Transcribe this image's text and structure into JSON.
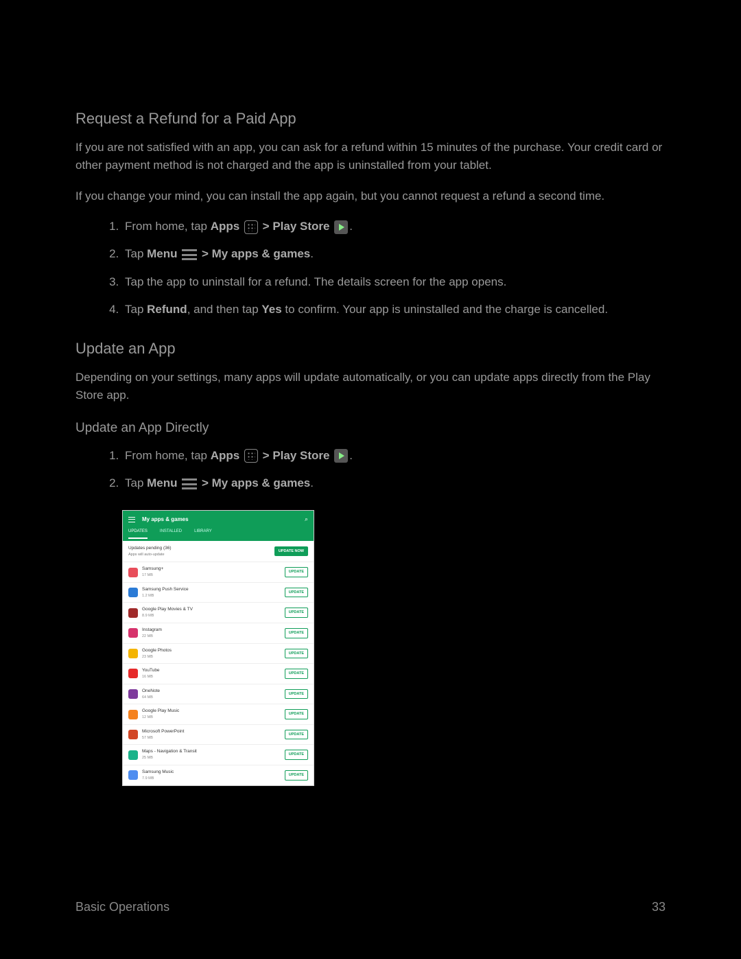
{
  "sections": {
    "refund_title": "Request a Refund for a Paid App",
    "refund_p1": "If you are not satisfied with an app, you can ask for a refund within 15 minutes of the purchase. Your credit card or other payment method is not charged and the app is uninstalled from your tablet.",
    "refund_p2": "If you change your mind, you can install the app again, but you cannot request a refund a second time.",
    "refund_steps": {
      "s1a": "From home, tap ",
      "s1b": "Apps",
      "s1c": " > ",
      "s1d": "Play Store",
      "s1e": ".",
      "s2a": "Tap ",
      "s2b": "Menu",
      "s2c": " > ",
      "s2d": "My apps & games",
      "s2e": ".",
      "s3": "Tap the app to uninstall for a refund. The details screen for the app opens.",
      "s4a": "Tap ",
      "s4b": "Refund",
      "s4c": ", and then tap ",
      "s4d": "Yes",
      "s4e": " to confirm. Your app is uninstalled and the charge is cancelled."
    },
    "update_title": "Update an App",
    "update_p1": "Depending on your settings, many apps will update automatically, or you can update apps directly from the Play Store app.",
    "update_sub": "Update an App Directly",
    "update_steps": {
      "s1a": "From home, tap ",
      "s1b": "Apps",
      "s1c": " > ",
      "s1d": "Play Store",
      "s1e": ".",
      "s2a": "Tap ",
      "s2b": "Menu",
      "s2c": " > ",
      "s2d": "My apps & games",
      "s2e": "."
    }
  },
  "screenshot": {
    "title": "My apps & games",
    "tabs": [
      "UPDATES",
      "INSTALLED",
      "LIBRARY"
    ],
    "pending_line1": "Updates pending (36)",
    "pending_line2": "Apps will auto-update",
    "update_now": "UPDATE NOW",
    "update_btn": "UPDATE",
    "apps": [
      {
        "name": "Samsung+",
        "size": "17 MB",
        "color": "#e84e5b"
      },
      {
        "name": "Samsung Push Service",
        "size": "1.2 MB",
        "color": "#2b7bd6"
      },
      {
        "name": "Google Play Movies & TV",
        "size": "8.9 MB",
        "color": "#a02a2a"
      },
      {
        "name": "Instagram",
        "size": "22 MB",
        "color": "#d6336c"
      },
      {
        "name": "Google Photos",
        "size": "23 MB",
        "color": "#f4b400"
      },
      {
        "name": "YouTube",
        "size": "16 MB",
        "color": "#e62a2a"
      },
      {
        "name": "OneNote",
        "size": "64 MB",
        "color": "#7e3b9c"
      },
      {
        "name": "Google Play Music",
        "size": "12 MB",
        "color": "#f5821f"
      },
      {
        "name": "Microsoft PowerPoint",
        "size": "57 MB",
        "color": "#d24726"
      },
      {
        "name": "Maps - Navigation & Transit",
        "size": "25 MB",
        "color": "#1bb38a"
      },
      {
        "name": "Samsung Music",
        "size": "7.9 MB",
        "color": "#4f8ef0"
      }
    ]
  },
  "footer": {
    "left": "Basic Operations",
    "right": "33"
  }
}
